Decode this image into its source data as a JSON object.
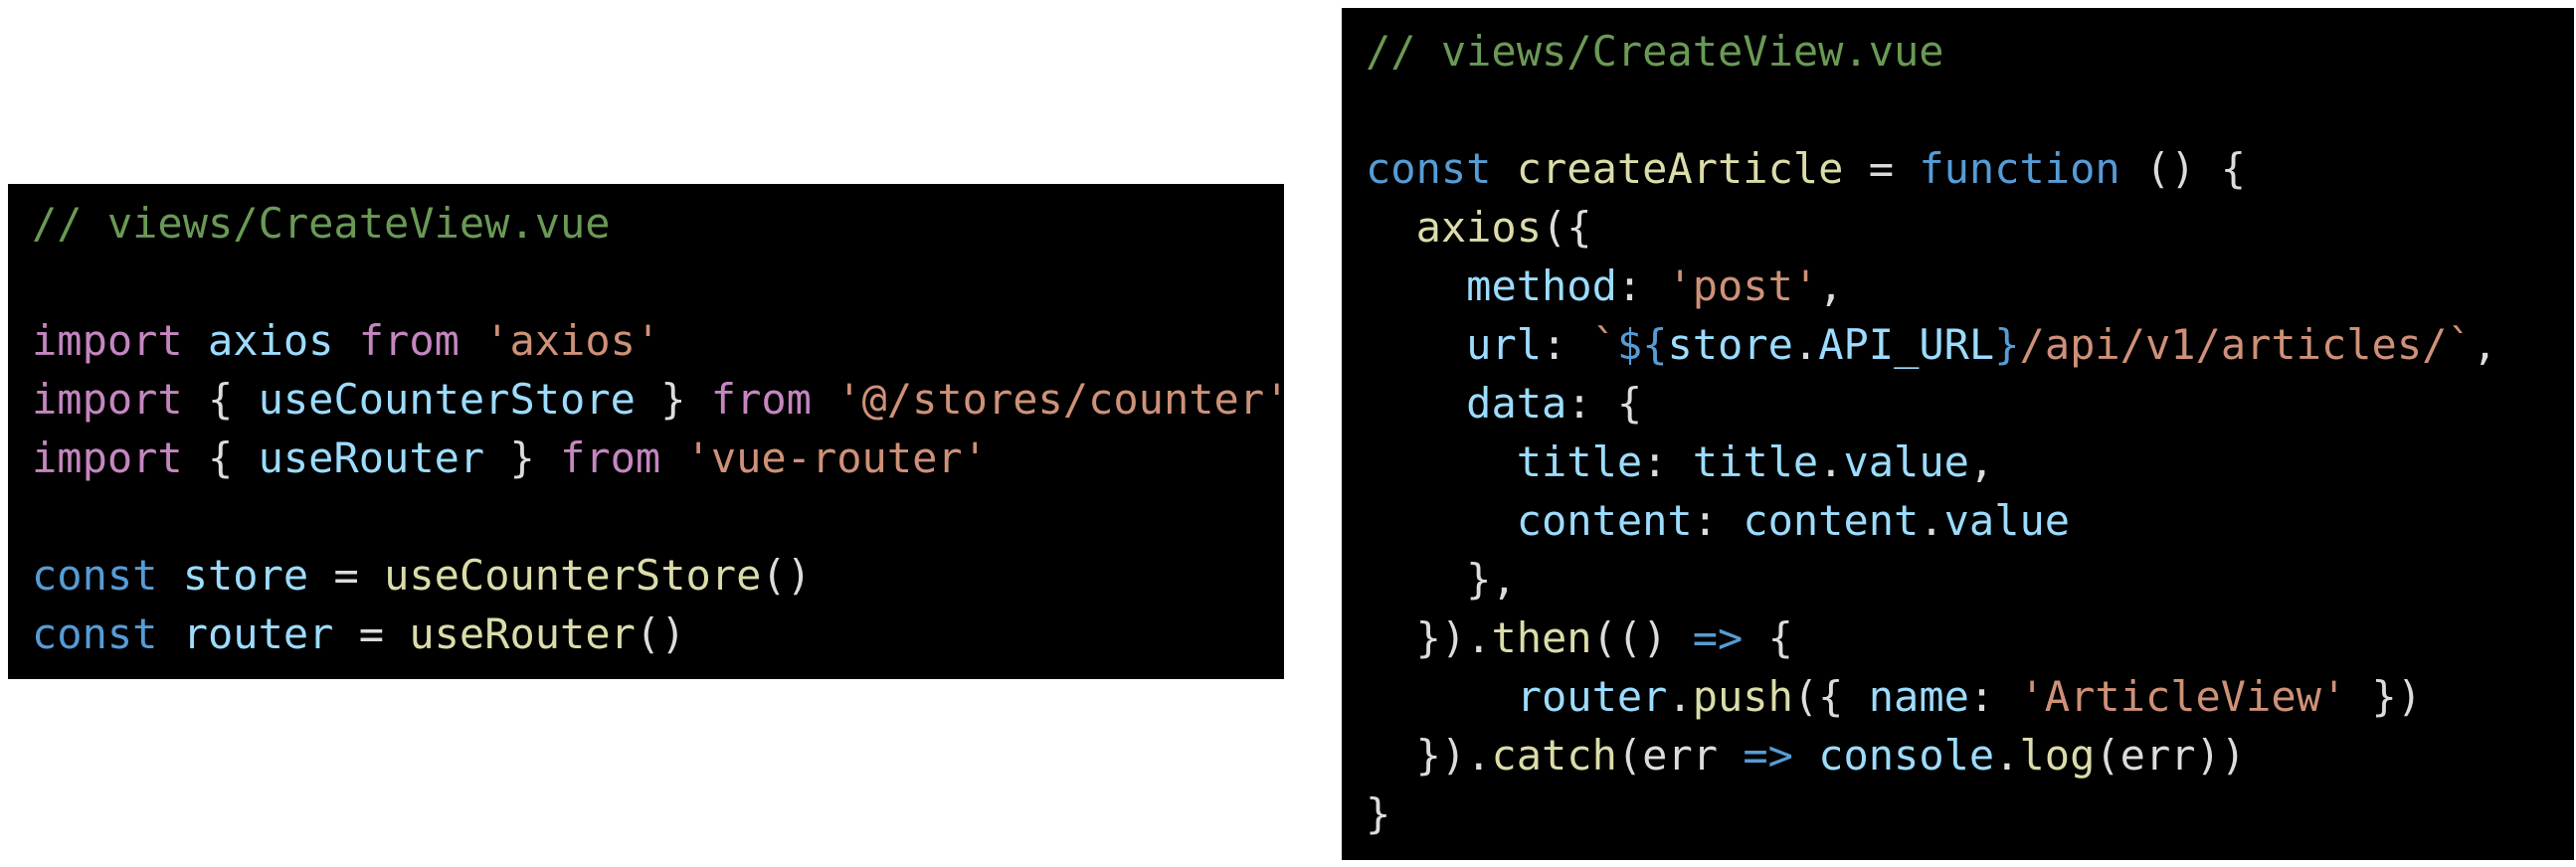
{
  "left_code": {
    "comment": "// views/CreateView.vue",
    "import1": {
      "kw": "import",
      "name": "axios",
      "from": "from",
      "src": "'axios'"
    },
    "import2": {
      "kw": "import",
      "open": "{",
      "name": "useCounterStore",
      "close": "}",
      "from": "from",
      "src": "'@/stores/counter'"
    },
    "import3": {
      "kw": "import",
      "open": "{",
      "name": "useRouter",
      "close": "}",
      "from": "from",
      "src": "'vue-router'"
    },
    "const1": {
      "kw": "const",
      "name": "store",
      "eq": "=",
      "call": "useCounterStore",
      "parens": "()"
    },
    "const2": {
      "kw": "const",
      "name": "router",
      "eq": "=",
      "call": "useRouter",
      "parens": "()"
    }
  },
  "right_code": {
    "comment": "// views/CreateView.vue",
    "l1": {
      "kw": "const",
      "name": "createArticle",
      "eq": "=",
      "fn": "function",
      "rest": "() {"
    },
    "l2": {
      "call": "axios",
      "rest": "({"
    },
    "l3": {
      "key": "method",
      "colon": ":",
      "val": "'post'",
      "comma": ","
    },
    "l4": {
      "key": "url",
      "colon": ":",
      "tick": "`",
      "interp_open": "${",
      "obj": "store",
      "dot": ".",
      "prop": "API_URL",
      "interp_close": "}",
      "path": "/api/v1/articles/`",
      "comma": ","
    },
    "l5": {
      "key": "data",
      "colon": ":",
      "brace": "{"
    },
    "l6": {
      "key": "title",
      "colon": ":",
      "obj": "title",
      "dot": ".",
      "prop": "value",
      "comma": ","
    },
    "l7": {
      "key": "content",
      "colon": ":",
      "obj": "content",
      "dot": ".",
      "prop": "value"
    },
    "l8": {
      "text": "},"
    },
    "l9": {
      "pre": "}).",
      "call": "then",
      "paren": "(()",
      "arrow": "=>",
      "brace": "{"
    },
    "l10": {
      "obj": "router",
      "dot": ".",
      "call": "push",
      "open": "({",
      "key": "name",
      "colon": ":",
      "val": "'ArticleView'",
      "close": "})"
    },
    "l11": {
      "pre": "}).",
      "call": "catch",
      "paren": "(err",
      "arrow": "=>",
      "obj": "console",
      "dot": ".",
      "fn": "log",
      "rest": "(err))"
    },
    "l12": {
      "text": "}"
    }
  },
  "colors": {
    "background": "#000000",
    "comment": "#6a9955",
    "keyword": "#c586c0",
    "storage": "#569cd6",
    "variable": "#9cdcfe",
    "function": "#dcdcaa",
    "string": "#ce9178",
    "plain": "#dcdcdc"
  }
}
